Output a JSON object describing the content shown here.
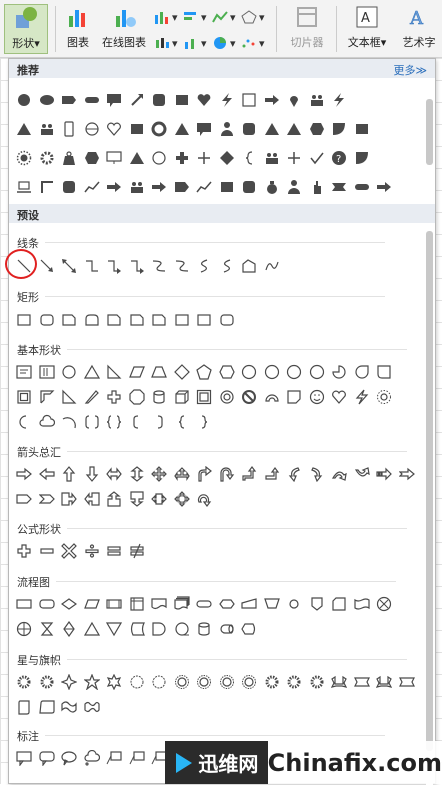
{
  "ribbon": {
    "shapes_label": "形状",
    "chart_label": "图表",
    "online_chart_label": "在线图表",
    "slicer_label": "切片器",
    "textbox_label": "文本框",
    "wordart_label": "艺术字",
    "colors": {
      "active_bg": "#d6e7c6",
      "chart_green": "#4caf50",
      "accent_blue": "#2a6ebb"
    }
  },
  "panel": {
    "recommend_title": "推荐",
    "more_label": "更多≫",
    "preset_title": "预设",
    "categories": {
      "lines": "线条",
      "rect": "矩形",
      "basic": "基本形状",
      "arrows": "箭头总汇",
      "formula": "公式形状",
      "flowchart": "流程图",
      "stars": "星与旗帜",
      "callouts": "标注"
    },
    "highlight_color": "#e02020"
  },
  "watermark": {
    "logo_text": "迅维网",
    "site": "Chinafix.com"
  }
}
